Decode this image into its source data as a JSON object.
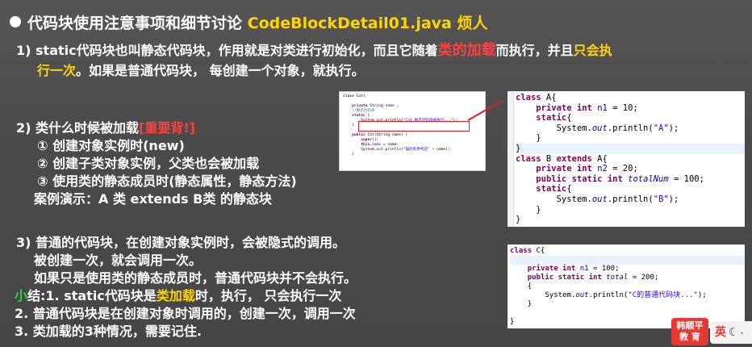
{
  "title": {
    "text": "代码块使用注意事项和细节讨论",
    "file": "CodeBlockDetail01.java",
    "suffix": "烦人"
  },
  "point1": {
    "a": "1) static代码块也叫静态代码块，作用就是对类进行初始化，而且它随着",
    "b": "类的加载",
    "c": "而执行，并且",
    "d": "只会执",
    "e": "行一次",
    "f": "。如果是普通代码块， 每创建一个对象，就执行。"
  },
  "point2": {
    "head": "2) 类什么时候被加载",
    "tag": "[重要背!]",
    "items": [
      "① 创建对象实例时(new)",
      "② 创建子类对象实例，父类也会被加载",
      "③ 使用类的静态成员时(静态属性，静态方法)"
    ],
    "demo": "案例演示：A 类 extends  B类 的静态块"
  },
  "point3": {
    "l1": "3) 普通的代码块，在创建对象实例时，会被隐式的调用。",
    "l2": "被创建一次，就会调用一次。",
    "l3": "如果只是使用类的静态成员时，普通代码块并不会执行。"
  },
  "summary": {
    "xiao": "小",
    "l1a": "结:1. static代码块是",
    "l1b": "类加载",
    "l1c": "时，执行，  只会执行一次",
    "l2": "2. 普通代码块是在创建对象时调用的，创建一次，调用一次",
    "l3": "3. 类加载的3种情况，需要记住."
  },
  "code_cat": [
    "class Cat{",
    "",
    "    private String name ;",
    "    //静态代码块",
    "    static {",
    "        System.out.println(\"Cat 静态代码块被执行...\");",
    "    }",
    "",
    "    public Cat(String name) {",
    "        super();",
    "        this.name = name;",
    "        System.out.println(\"猫的有参构造\" + name);",
    "    }"
  ],
  "code_a": [
    "class A{",
    "    private int n1 = 10;",
    "    static{",
    "        System.out.println(\"A\");",
    "    }",
    "}",
    "class B extends A{",
    "    private int n2 = 20;",
    "    public static int totalNum = 100;",
    "    static{",
    "        System.out.println(\"B\");",
    "    }",
    "}"
  ],
  "code_c": [
    "class C{",
    "",
    "    private int n1 = 100;",
    "    public static int total = 200;",
    "    {",
    "        System.out.println(\"C的普通代码块...\");",
    "    }",
    "",
    "}"
  ],
  "logo": {
    "l1": "韩顺平",
    "l2": "教 育"
  },
  "ime": {
    "label": "英"
  },
  "colors": {
    "highlight": "#ffd400",
    "red": "#ff4040",
    "green": "#35d03c",
    "background": "#4b4b4b"
  }
}
